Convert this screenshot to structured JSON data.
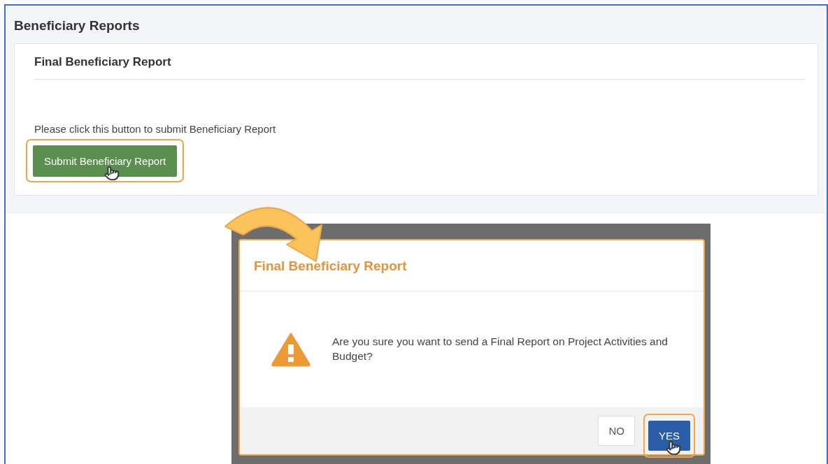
{
  "page": {
    "title": "Beneficiary Reports"
  },
  "card": {
    "title": "Final Beneficiary Report",
    "text": "Please click this button to submit Beneficiary Report",
    "button": "Submit Beneficiary Report"
  },
  "dialog": {
    "title": "Final Beneficiary Report",
    "message": "Are you sure you want to send a Final Report on Project Activities and Budget?",
    "buttons": [
      {
        "label": "NO",
        "kind": "secondary"
      },
      {
        "label": "YES",
        "kind": "primary"
      }
    ]
  }
}
